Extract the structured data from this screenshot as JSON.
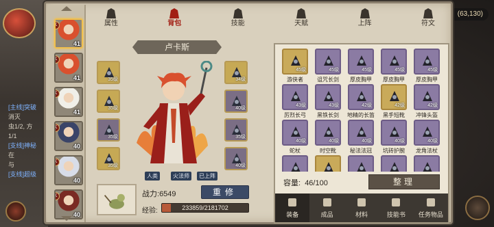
{
  "coords": "(63,130)",
  "quest_log": [
    {
      "text": "[主线]突破",
      "highlight": true
    },
    {
      "text": "消灭",
      "highlight": false
    },
    {
      "text": "虫1/2, 方",
      "highlight": false
    },
    {
      "text": "1/1",
      "highlight": false
    },
    {
      "text": "[支线]神秘",
      "highlight": true
    },
    {
      "text": "在",
      "highlight": false
    },
    {
      "text": "与",
      "highlight": false
    },
    {
      "text": "[支线]超级",
      "highlight": true
    }
  ],
  "tabs": [
    {
      "label": "属性",
      "icon": "fire-icon"
    },
    {
      "label": "背包",
      "icon": "backpack-icon",
      "active": true
    },
    {
      "label": "技能",
      "icon": "book-icon"
    },
    {
      "label": "天赋",
      "icon": "star-altar-icon"
    },
    {
      "label": "上阵",
      "icon": "crossed-swords-icon"
    },
    {
      "label": "符文",
      "icon": "rune-tower-icon"
    }
  ],
  "roster": [
    {
      "level": "41",
      "class": "K",
      "selected": true,
      "hair": "#d9502e"
    },
    {
      "level": "41",
      "class": "K",
      "selected": false,
      "hair": "#d9502e"
    },
    {
      "level": "41",
      "class": "K",
      "selected": false,
      "hair": "#f0efe8"
    },
    {
      "level": "40",
      "class": "K",
      "selected": false,
      "hair": "#3a4468"
    },
    {
      "level": "40",
      "class": "K",
      "selected": false,
      "hair": "#d8dde8"
    },
    {
      "level": "40",
      "class": "K",
      "selected": false,
      "hair": "#7a2a24"
    }
  ],
  "hero": {
    "name": "卢卡斯",
    "tags": [
      "人类",
      "火法师",
      "已上阵"
    ],
    "power_label": "战力:",
    "power_value": "6549",
    "train_label": "重修",
    "exp_label": "经验:",
    "exp_text": "233859/2181702",
    "exp_fraction": 0.107
  },
  "equipped_left": [
    {
      "level": "35级",
      "icon": "helmet-icon",
      "gold": true
    },
    {
      "level": "35级",
      "icon": "armor-icon",
      "gold": true
    },
    {
      "level": "35级",
      "icon": "robe-icon",
      "gold": false
    },
    {
      "level": "35级",
      "icon": "boots-icon",
      "gold": true
    }
  ],
  "equipped_right": [
    {
      "level": "34级",
      "icon": "owl-helm-icon",
      "gold": true
    },
    {
      "level": "40级",
      "icon": "axe-icon",
      "gold": false
    },
    {
      "level": "35级",
      "icon": "gauntlet-icon",
      "gold": false
    },
    {
      "level": "40级",
      "icon": "bow-icon",
      "gold": false
    }
  ],
  "bag": {
    "items": [
      {
        "name": "游侠者",
        "level": "45级",
        "gold": true
      },
      {
        "name": "诅咒长剑",
        "level": "45级",
        "gold": false
      },
      {
        "name": "厚皮胸甲",
        "level": "45级",
        "gold": false
      },
      {
        "name": "厚皮胸甲",
        "level": "45级",
        "gold": false
      },
      {
        "name": "厚皮胸甲",
        "level": "45级",
        "gold": false
      },
      {
        "name": "厉烈长弓",
        "level": "43级",
        "gold": false
      },
      {
        "name": "黑铁长剑",
        "level": "43级",
        "gold": false
      },
      {
        "name": "地精的长笛",
        "level": "42级",
        "gold": false
      },
      {
        "name": "黑手短靴",
        "level": "42级",
        "gold": true
      },
      {
        "name": "冲锋头盔",
        "level": "42级",
        "gold": false
      },
      {
        "name": "蛇杖",
        "level": "40级",
        "gold": false
      },
      {
        "name": "时空靴",
        "level": "40级",
        "gold": false
      },
      {
        "name": "秘法法冠",
        "level": "40级",
        "gold": false
      },
      {
        "name": "坑砖护腕",
        "level": "40级",
        "gold": false
      },
      {
        "name": "龙角法杖",
        "level": "40级",
        "gold": false
      },
      {
        "name": "",
        "level": "",
        "gold": false
      },
      {
        "name": "",
        "level": "",
        "gold": true
      },
      {
        "name": "",
        "level": "",
        "gold": false
      },
      {
        "name": "",
        "level": "",
        "gold": false
      },
      {
        "name": "",
        "level": "",
        "gold": false
      }
    ],
    "capacity_label": "容量:",
    "capacity_value": "46/100",
    "sort_label": "整理",
    "categories": [
      {
        "label": "装备",
        "icon": "equipment-icon",
        "active": true
      },
      {
        "label": "成品",
        "icon": "product-icon"
      },
      {
        "label": "材料",
        "icon": "material-icon"
      },
      {
        "label": "技能书",
        "icon": "skillbook-icon"
      },
      {
        "label": "任务物品",
        "icon": "quest-item-icon"
      }
    ]
  },
  "colors": {
    "accent_red": "#a21f14",
    "slot_purple": "#8b7ba3",
    "slot_gold": "#c9aa5a",
    "button_blue": "#3b4a66"
  }
}
